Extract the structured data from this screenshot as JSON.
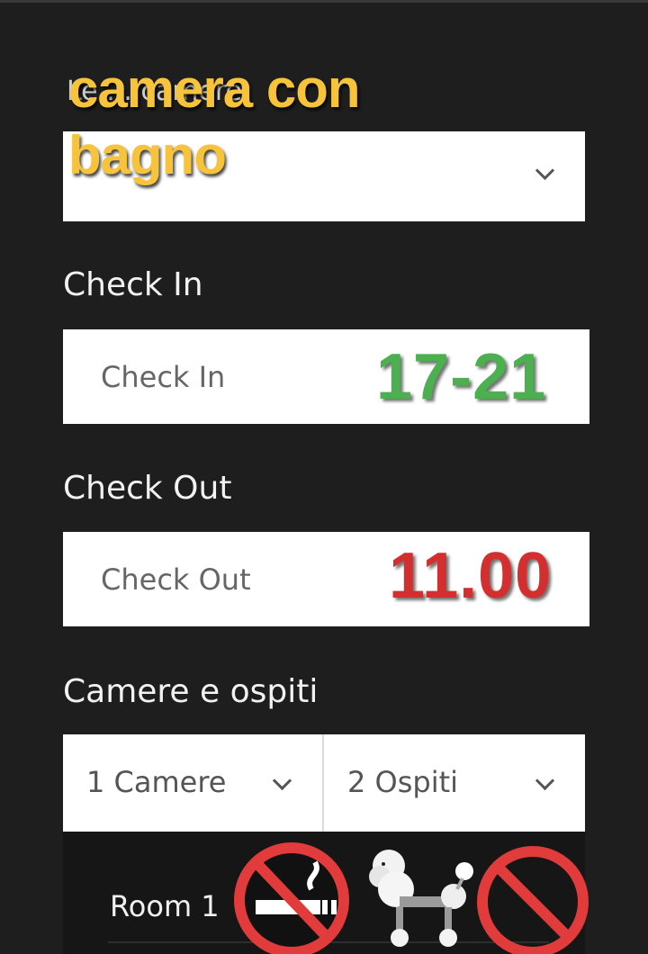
{
  "overlay": {
    "title_line1": "camera con",
    "title_line2": "bagno",
    "title_color": "#f6c33a"
  },
  "room_type": {
    "partially_hidden_label": "Le ... camere",
    "icon": "chevron-down-icon"
  },
  "check_in": {
    "label": "Check In",
    "placeholder": "Check In",
    "hours_overlay": "17-21",
    "hours_color": "#4caf50"
  },
  "check_out": {
    "label": "Check Out",
    "placeholder": "Check Out",
    "time_overlay": "11.00",
    "time_color": "#d32f2f"
  },
  "rooms_guests": {
    "label": "Camere e ospiti",
    "rooms_value": "1 Camere",
    "guests_value": "2 Ospiti"
  },
  "room_panel": {
    "room_label": "Room 1",
    "icons": [
      "no-smoking-icon",
      "poodle-icon",
      "prohibited-icon"
    ]
  }
}
